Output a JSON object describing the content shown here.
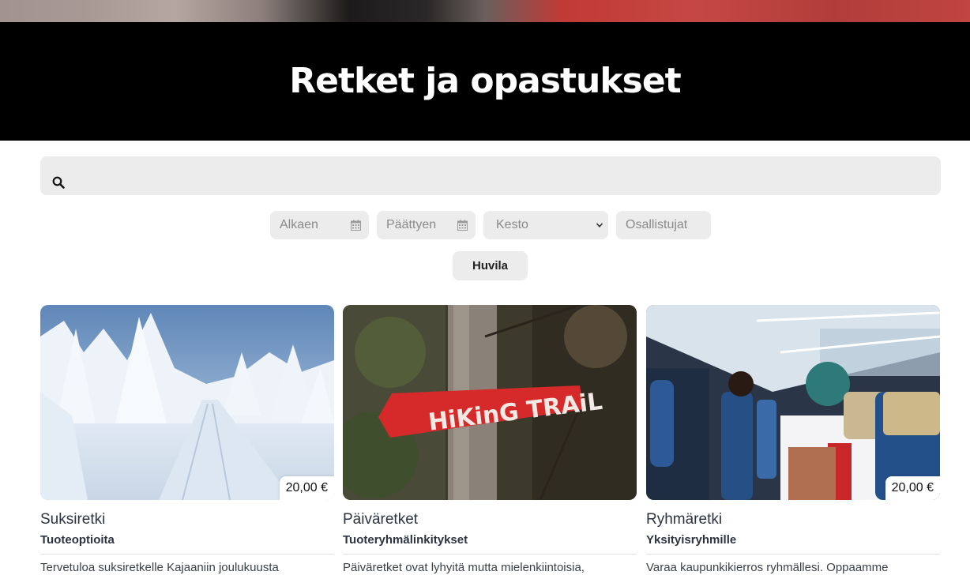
{
  "page": {
    "title": "Retket ja opastukset"
  },
  "search": {
    "placeholder": "",
    "icon": "search-icon"
  },
  "filters": {
    "start_placeholder": "Alkaen",
    "end_placeholder": "Päättyen",
    "duration_selected": "Kesto",
    "participants_placeholder": "Osallistujat",
    "calendar_icon": "calendar-icon",
    "chevron_icon": "chevron-down-icon"
  },
  "apply_button": {
    "label": "Huvila"
  },
  "cards": [
    {
      "title": "Suksiretki",
      "subtitle": "Tuoteoptioita",
      "description": "Tervetuloa suksiretkelle Kajaaniin joulukuusta",
      "price": "20,00 €",
      "image": "snowy-forest-ski-trail"
    },
    {
      "title": "Päiväretket",
      "subtitle": "Tuoteryhmälinkitykset",
      "description": "Päiväretket ovat lyhyitä mutta mielenkiintoisia,",
      "price": "",
      "image": "hiking-trail-sign"
    },
    {
      "title": "Ryhmäretki",
      "subtitle": "Yksityisryhmille",
      "description": "Varaa kaupunkikierros ryhmällesi. Oppaamme",
      "price": "20,00 €",
      "image": "bus-interior-passengers"
    }
  ],
  "colors": {
    "hero_background": "#000000",
    "field_background": "#ececec",
    "heading_text": "#2d3340"
  }
}
